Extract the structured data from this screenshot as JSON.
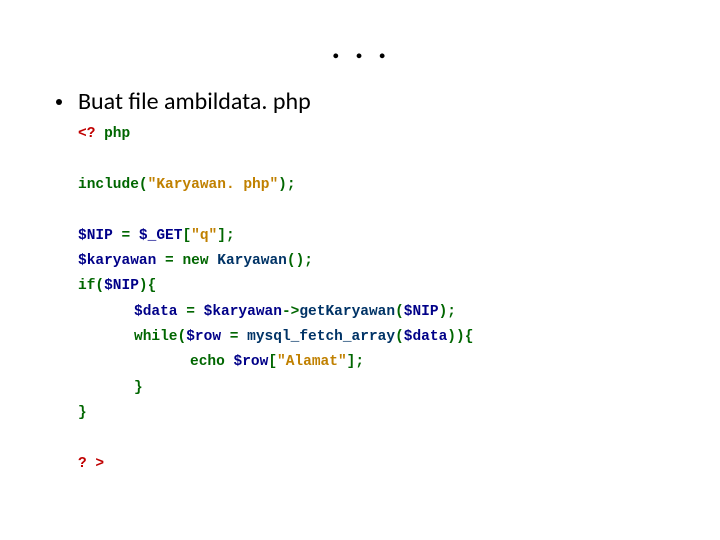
{
  "title": ". . .",
  "bullet": "Buat file ambildata. php",
  "code": {
    "l0_open": "<? ",
    "l0_php": "php",
    "l1_include": "include",
    "l1_p1": "(",
    "l1_str": "\"Karyawan. php\"",
    "l1_p2": ")",
    "l1_semi": ";",
    "l2_var": "$NIP",
    "l2_eq": " = ",
    "l2_get": "$_GET",
    "l2_b1": "[",
    "l2_str": "\"q\"",
    "l2_b2": "]",
    "l2_semi": ";",
    "l3_var": "$karyawan",
    "l3_eq": " = ",
    "l3_new": "new",
    "l3_sp": " ",
    "l3_cls": "Karyawan",
    "l3_p": "()",
    "l3_semi": ";",
    "l4_if": "if",
    "l4_p1": "(",
    "l4_var": "$NIP",
    "l4_p2": ")",
    "l4_brace": "{",
    "l5_var": "$data",
    "l5_eq": " = ",
    "l5_obj": "$karyawan",
    "l5_arrow": "->",
    "l5_meth": "getKaryawan",
    "l5_p1": "(",
    "l5_arg": "$NIP",
    "l5_p2": ")",
    "l5_semi": ";",
    "l6_while": "while",
    "l6_p1": "(",
    "l6_row": "$row",
    "l6_eq": " = ",
    "l6_fn": "mysql_fetch_array",
    "l6_p2": "(",
    "l6_arg": "$data",
    "l6_p3": "))",
    "l6_brace": "{",
    "l7_echo": "echo",
    "l7_sp": " ",
    "l7_row": "$row",
    "l7_b1": "[",
    "l7_str": "\"Alamat\"",
    "l7_b2": "]",
    "l7_semi": ";",
    "l8_brace": "}",
    "l9_brace": "}",
    "l10_close": "? >"
  }
}
